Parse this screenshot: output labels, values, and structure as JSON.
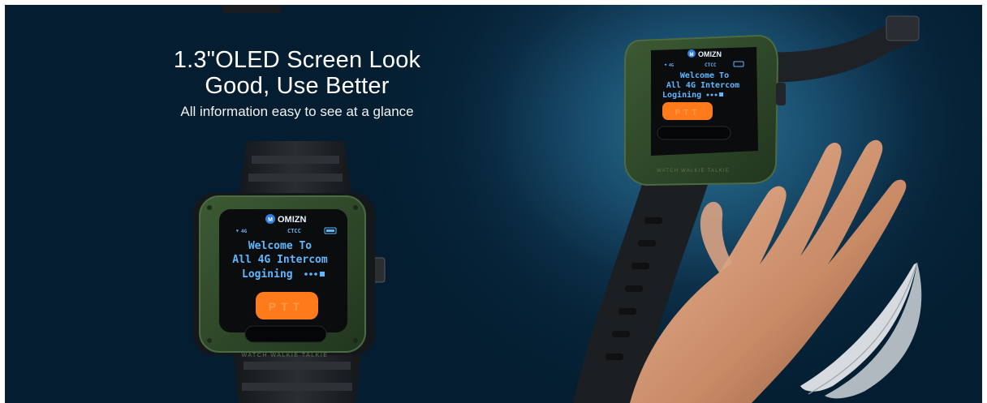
{
  "headline": {
    "title_line1": "1.3\"OLED Screen Look",
    "title_line2": "Good, Use Better",
    "subtitle": "All information easy to see at a glance"
  },
  "watch_front": {
    "brand": "OMIZN",
    "brand_badge": "M",
    "status_signal": "4G",
    "status_right": "CTCC",
    "screen_line1": "Welcome To",
    "screen_line2": "All 4G Intercom",
    "screen_line3": "Logining",
    "button_label": "PTT",
    "bezel_text": "WATCH WALKIE TALKIE"
  },
  "watch_angled": {
    "brand": "OMIZN",
    "brand_badge": "M",
    "status_signal": "4G",
    "status_right": "CTCC",
    "screen_line1": "Welcome To",
    "screen_line2": "All 4G Intercom",
    "screen_line3": "Logining",
    "button_label": "PTT",
    "bezel_text": "WATCH WALKIE TALKIE"
  },
  "colors": {
    "background": "#062338",
    "case_green": "#2f4a2a",
    "screen_text": "#5fb8ff",
    "ptt_orange": "#ff7a1a",
    "strap": "#1c1f22"
  }
}
